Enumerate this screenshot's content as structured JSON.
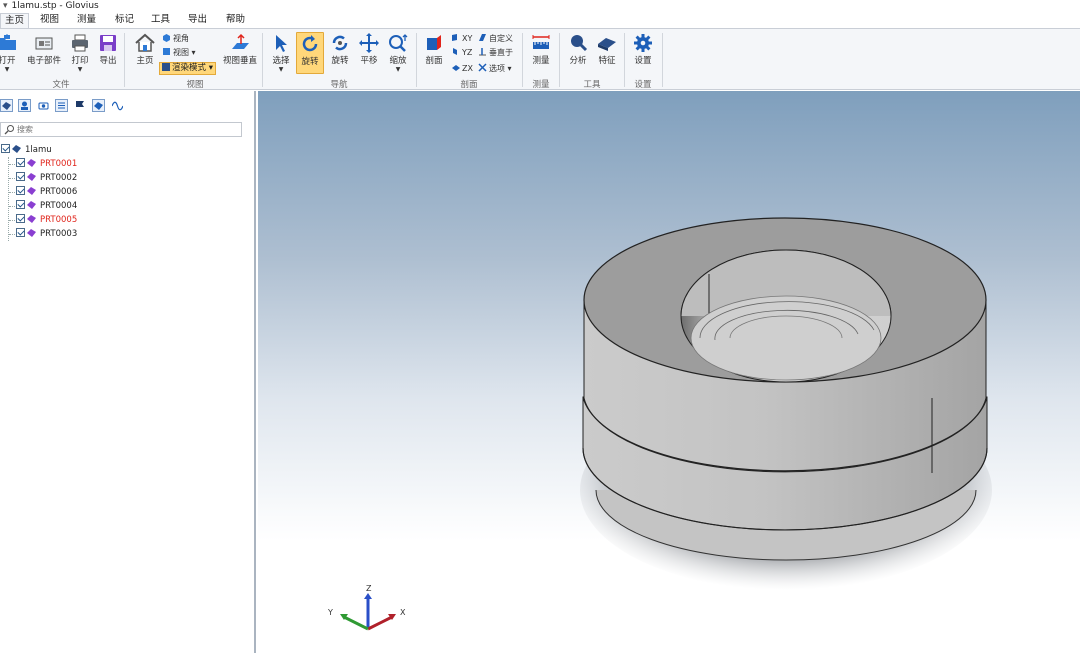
{
  "window": {
    "title": "1lamu.stp - Glovius",
    "quick_access": "▾"
  },
  "menu": {
    "tabs": [
      "主页",
      "视图",
      "测量",
      "标记",
      "工具",
      "导出",
      "帮助"
    ],
    "active_tab": "主页"
  },
  "ribbon": {
    "file": {
      "open": "打开",
      "ecad": "电子部件",
      "print": "打印",
      "export": "导出",
      "group": "文件"
    },
    "view": {
      "home": "主页",
      "angle": "视角",
      "views": "视图",
      "render_mode": "渲染模式",
      "perpendicular": "视图垂直",
      "group": "视图"
    },
    "nav": {
      "select": "选择",
      "rotate": "旋转",
      "rotate2": "旋转",
      "pan": "平移",
      "zoom": "缩放",
      "group": "导航"
    },
    "section": {
      "section": "剖面",
      "xy": "XY",
      "yz": "YZ",
      "zx": "ZX",
      "custom": "自定义",
      "vertical": "垂直于",
      "options": "选项",
      "group": "剖面"
    },
    "measure": {
      "measure": "测量",
      "group": "测量"
    },
    "tools": {
      "analyze": "分析",
      "feature": "特征",
      "group": "工具"
    },
    "settings": {
      "settings": "设置",
      "group": "设置"
    }
  },
  "panel": {
    "search_placeholder": "搜索",
    "root": "1lamu",
    "parts": [
      {
        "name": "PRT0001",
        "color": "#e0241b"
      },
      {
        "name": "PRT0002",
        "color": "#1e1e1e"
      },
      {
        "name": "PRT0006",
        "color": "#1e1e1e"
      },
      {
        "name": "PRT0004",
        "color": "#1e1e1e"
      },
      {
        "name": "PRT0005",
        "color": "#e0241b"
      },
      {
        "name": "PRT0003",
        "color": "#1e1e1e"
      }
    ]
  },
  "triad": {
    "x": "X",
    "y": "Y",
    "z": "Z"
  },
  "colors": {
    "accent": "#ffd77a",
    "ribbon_bg": "#f4f6f9",
    "part_icon": "#8a3fd1",
    "selected_text": "#e0241b"
  }
}
